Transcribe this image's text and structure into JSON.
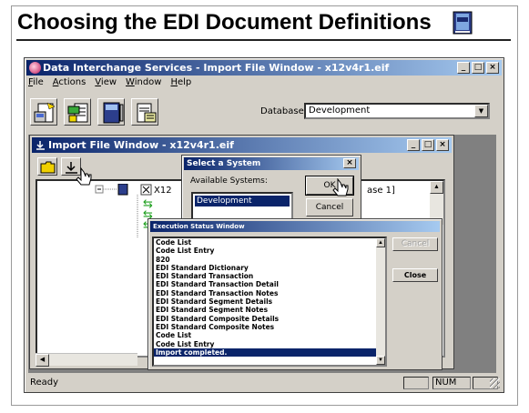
{
  "slide": {
    "title": "Choosing the EDI Document Definitions"
  },
  "app": {
    "title": "Data Interchange Services - Import File Window - x12v4r1.eif",
    "menu": [
      "File",
      "Actions",
      "View",
      "Window",
      "Help"
    ],
    "database_label": "Database",
    "database_value": "Development",
    "status_ready": "Ready",
    "status_num": "NUM",
    "win_min": "_",
    "win_max": "□",
    "win_close": "×"
  },
  "import_window": {
    "title": "Import File Window - x12v4r1.eif",
    "tree_item": "X12",
    "tree_item_tail": "ase 1]"
  },
  "select_system": {
    "title": "Select a System",
    "label": "Available Systems:",
    "items": [
      "Development"
    ],
    "ok": "OK",
    "cancel": "Cancel",
    "close_glyph": "×"
  },
  "execution_status": {
    "title": "Execution Status Window",
    "lines": [
      "Code List",
      "Code List Entry",
      "820",
      "EDI Standard Dictionary",
      "EDI Standard Transaction",
      "EDI Standard Transaction Detail",
      "EDI Standard Transaction Notes",
      "EDI Standard Segment Details",
      "EDI Standard Segment Notes",
      "EDI Standard Composite Details",
      "EDI Standard Composite Notes",
      "Code List",
      "Code List Entry",
      "Import completed."
    ],
    "selected_index": 13,
    "cancel": "Cancel",
    "close": "Close"
  }
}
